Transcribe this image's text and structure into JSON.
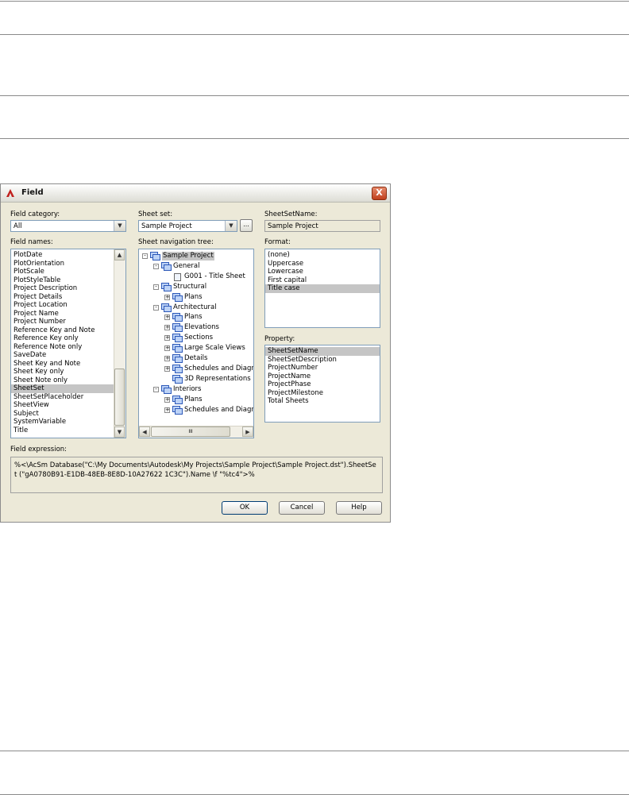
{
  "dialog": {
    "title": "Field",
    "close_label": "X"
  },
  "field_category": {
    "label": "Field category:",
    "value": "All"
  },
  "sheet_set": {
    "label": "Sheet set:",
    "value": "Sample Project",
    "browse_label": "..."
  },
  "sheet_set_name": {
    "label": "SheetSetName:",
    "value": "Sample Project"
  },
  "field_names": {
    "label": "Field names:",
    "items": [
      "PlotDate",
      "PlotOrientation",
      "PlotScale",
      "PlotStyleTable",
      "Project Description",
      "Project Details",
      "Project Location",
      "Project Name",
      "Project Number",
      "Reference Key and Note",
      "Reference Key only",
      "Reference Note only",
      "SaveDate",
      "Sheet Key and Note",
      "Sheet Key only",
      "Sheet Note only",
      "SheetSet",
      "SheetSetPlaceholder",
      "SheetView",
      "Subject",
      "SystemVariable",
      "Title"
    ],
    "selected": "SheetSet"
  },
  "tree": {
    "label": "Sheet navigation tree:",
    "nodes": [
      {
        "label": "Sample Project",
        "level": 0,
        "expander": "-",
        "selected": true
      },
      {
        "label": "General",
        "level": 1,
        "expander": "-"
      },
      {
        "label": "G001 - Title Sheet",
        "level": 2,
        "expander": ""
      },
      {
        "label": "Structural",
        "level": 1,
        "expander": "-"
      },
      {
        "label": "Plans",
        "level": 2,
        "expander": "+"
      },
      {
        "label": "Architectural",
        "level": 1,
        "expander": "-"
      },
      {
        "label": "Plans",
        "level": 2,
        "expander": "+"
      },
      {
        "label": "Elevations",
        "level": 2,
        "expander": "+"
      },
      {
        "label": "Sections",
        "level": 2,
        "expander": "+"
      },
      {
        "label": "Large Scale Views",
        "level": 2,
        "expander": "+"
      },
      {
        "label": "Details",
        "level": 2,
        "expander": "+"
      },
      {
        "label": "Schedules and Diagr",
        "level": 2,
        "expander": "+"
      },
      {
        "label": "3D Representations",
        "level": 2,
        "expander": ""
      },
      {
        "label": "Interiors",
        "level": 1,
        "expander": "-"
      },
      {
        "label": "Plans",
        "level": 2,
        "expander": "+"
      },
      {
        "label": "Schedules and Diagr",
        "level": 2,
        "expander": "+"
      }
    ],
    "hscroll_grip": "III"
  },
  "format": {
    "label": "Format:",
    "items": [
      "(none)",
      "Uppercase",
      "Lowercase",
      "First capital",
      "Title case"
    ],
    "selected": "Title case"
  },
  "property": {
    "label": "Property:",
    "items": [
      "SheetSetName",
      "SheetSetDescription",
      "ProjectNumber",
      "ProjectName",
      "ProjectPhase",
      "ProjectMilestone",
      "Total Sheets"
    ],
    "selected": "SheetSetName"
  },
  "field_expression": {
    "label": "Field expression:",
    "value": "%<\\AcSm Database(\"C:\\My Documents\\Autodesk\\My Projects\\Sample Project\\Sample Project.dst\").SheetSet (\"gA0780B91-E1DB-48EB-8E8D-10A27622 1C3C\").Name \\f \"%tc4\">%"
  },
  "buttons": {
    "ok": "OK",
    "cancel": "Cancel",
    "help": "Help"
  }
}
